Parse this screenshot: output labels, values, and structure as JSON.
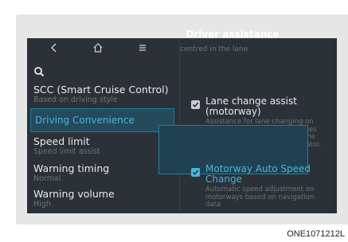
{
  "left_list": [
    {
      "title": "SCC (Smart Cruise Control)",
      "sub": "Based on driving style"
    },
    {
      "title": "Driving Convenience",
      "sub": ""
    },
    {
      "title": "Speed limit",
      "sub": "Speed limit assist"
    },
    {
      "title": "Warning timing",
      "sub": "Normal"
    },
    {
      "title": "Warning volume",
      "sub": "High"
    }
  ],
  "right_panel": {
    "title": "Driver assistance",
    "fragment": "centred in the lane",
    "options": [
      {
        "title": "Lane change assist (motorway)",
        "desc": "Assistance for lane changing on motorways. The vehicle changes the lane automatically when the driver activates the turn indicator.",
        "checked": true
      },
      {
        "title": "Motorway Auto Speed Change",
        "desc": "Automatic speed adjustment on motorways based on navigation data",
        "checked": true
      }
    ]
  },
  "caption": "ONE1071212L",
  "colors": {
    "screen_bg": "#2b3136",
    "accent": "#49b6db",
    "highlight_bg": "#244a5c"
  }
}
